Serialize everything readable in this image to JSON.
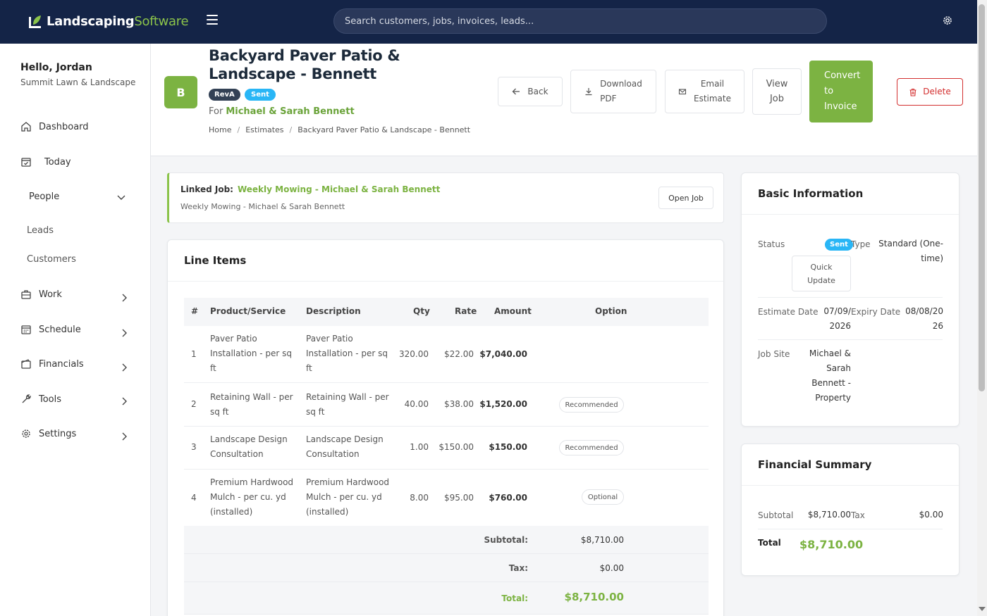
{
  "app": {
    "logo_main": "Landscaping",
    "logo_accent": "Software",
    "search_placeholder": "Search customers, jobs, invoices, leads..."
  },
  "sidebar": {
    "greeting": "Hello, Jordan",
    "company": "Summit Lawn & Landscape",
    "items": {
      "dashboard": "Dashboard",
      "today": "Today",
      "people": "People",
      "leads": "Leads",
      "customers": "Customers",
      "work": "Work",
      "schedule": "Schedule",
      "financials": "Financials",
      "tools": "Tools",
      "settings": "Settings"
    }
  },
  "header": {
    "avatar": "B",
    "title": "Backyard Paver Patio & Landscape - Bennett",
    "revision": "RevA",
    "status": "Sent",
    "for_label": "For",
    "customer": "Michael & Sarah Bennett",
    "breadcrumb": [
      "Home",
      "Estimates",
      "Backyard Paver Patio & Landscape - Bennett"
    ],
    "breadcrumb_sep": "/",
    "buttons": {
      "back": "Back",
      "download_1": "Download",
      "download_2": "PDF",
      "email_1": "Email",
      "email_2": "Estimate",
      "view_1": "View",
      "view_2": "Job",
      "convert_1": "Convert",
      "convert_2": "to",
      "convert_3": "Invoice",
      "delete": "Delete"
    }
  },
  "linked_job": {
    "label": "Linked Job:",
    "name": "Weekly Mowing - Michael & Sarah Bennett",
    "subtitle": "Weekly Mowing - Michael & Sarah Bennett",
    "open_button": "Open Job"
  },
  "line_items": {
    "title": "Line Items",
    "columns": {
      "num": "#",
      "product": "Product/Service",
      "description": "Description",
      "qty": "Qty",
      "rate": "Rate",
      "amount": "Amount",
      "option": "Option"
    },
    "rows": [
      {
        "num": "1",
        "product": [
          "Paver Patio",
          "Installation - per sq",
          "ft"
        ],
        "description": [
          "Paver Patio",
          "Installation - per sq",
          "ft"
        ],
        "qty": "320.00",
        "rate": "$22.00",
        "amount": "$7,040.00",
        "option": ""
      },
      {
        "num": "2",
        "product": [
          "Retaining Wall - per",
          "sq ft"
        ],
        "description": [
          "Retaining Wall - per",
          "sq ft"
        ],
        "qty": "40.00",
        "rate": "$38.00",
        "amount": "$1,520.00",
        "option": "Recommended"
      },
      {
        "num": "3",
        "product": [
          "Landscape Design",
          "Consultation"
        ],
        "description": [
          "Landscape Design",
          "Consultation"
        ],
        "qty": "1.00",
        "rate": "$150.00",
        "amount": "$150.00",
        "option": "Recommended"
      },
      {
        "num": "4",
        "product": [
          "Premium Hardwood",
          "Mulch - per cu. yd",
          "(installed)"
        ],
        "description": [
          "Premium Hardwood",
          "Mulch - per cu. yd",
          "(installed)"
        ],
        "qty": "8.00",
        "rate": "$95.00",
        "amount": "$760.00",
        "option": "Optional"
      }
    ],
    "subtotal_label": "Subtotal:",
    "subtotal": "$8,710.00",
    "tax_label": "Tax:",
    "tax": "$0.00",
    "total_label": "Total:",
    "total": "$8,710.00"
  },
  "basic_info": {
    "title": "Basic Information",
    "status_label": "Status",
    "status": "Sent",
    "quick_update_1": "Quick",
    "quick_update_2": "Update",
    "type_label": "Type",
    "type_1": "Standard (One-",
    "type_2": "time)",
    "estimate_date_label": "Estimate Date",
    "estimate_date_1": "07/09/",
    "estimate_date_2": "2026",
    "expiry_label": "Expiry Date",
    "expiry_1": "08/08/20",
    "expiry_2": "26",
    "job_site_label": "Job Site",
    "job_site": [
      "Michael &",
      "Sarah",
      "Bennett -",
      "Property"
    ]
  },
  "financial_summary": {
    "title": "Financial Summary",
    "subtotal_label": "Subtotal",
    "subtotal": "$8,710.00",
    "tax_label": "Tax",
    "tax": "$0.00",
    "total_label": "Total",
    "total": "$8,710.00"
  },
  "colors": {
    "navy": "#142447",
    "green": "#7cb342",
    "sent_blue": "#29b6f6",
    "delete_red": "#d32f2f"
  }
}
